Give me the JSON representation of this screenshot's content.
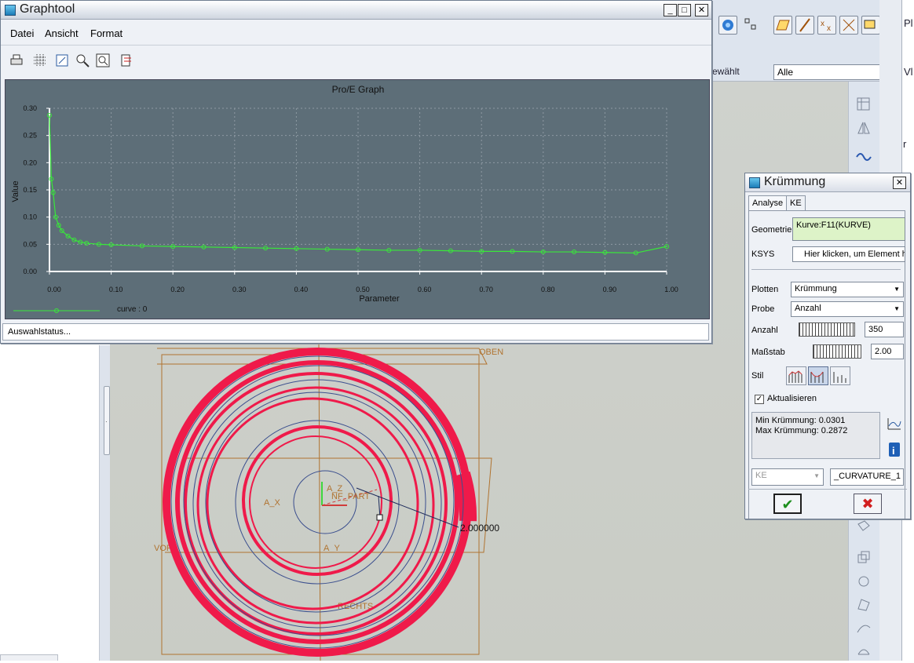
{
  "graphtool": {
    "title": "Graphtool",
    "menu": [
      "Datei",
      "Ansicht",
      "Format"
    ],
    "status": "Auswahlstatus...",
    "toolbar_icons": [
      "printer-icon",
      "grid-toggle-icon",
      "zoom-fit-icon",
      "zoom-in-icon",
      "zoom-window-icon",
      "export-icon"
    ]
  },
  "chart_data": {
    "type": "line",
    "title": "Pro/E Graph",
    "xlabel": "Parameter",
    "ylabel": "Value",
    "xlim": [
      0,
      1
    ],
    "ylim": [
      0,
      0.3
    ],
    "xticks": [
      "0.00",
      "0.10",
      "0.20",
      "0.30",
      "0.40",
      "0.50",
      "0.60",
      "0.70",
      "0.80",
      "0.90",
      "1.00"
    ],
    "yticks": [
      "0.00",
      "0.05",
      "0.10",
      "0.15",
      "0.20",
      "0.25",
      "0.30"
    ],
    "grid": true,
    "legend": "bottom-left",
    "series": [
      {
        "name": "curve : 0",
        "color": "#39e83a",
        "x": [
          0,
          0.003,
          0.006,
          0.01,
          0.015,
          0.02,
          0.03,
          0.04,
          0.05,
          0.06,
          0.08,
          0.1,
          0.15,
          0.2,
          0.25,
          0.3,
          0.35,
          0.4,
          0.45,
          0.5,
          0.55,
          0.6,
          0.65,
          0.7,
          0.75,
          0.8,
          0.85,
          0.9,
          0.95,
          1.0
        ],
        "y": [
          0.287,
          0.17,
          0.145,
          0.1,
          0.085,
          0.075,
          0.065,
          0.058,
          0.054,
          0.052,
          0.05,
          0.049,
          0.047,
          0.046,
          0.045,
          0.044,
          0.043,
          0.042,
          0.041,
          0.04,
          0.039,
          0.039,
          0.038,
          0.037,
          0.037,
          0.036,
          0.036,
          0.035,
          0.034,
          0.046
        ]
      }
    ]
  },
  "dialog": {
    "title": "Krümmung",
    "tabs": [
      "Analyse",
      "KE"
    ],
    "geometrie_label": "Geometrie",
    "geometrie_value": "Kurve:F11(KURVE)",
    "ksys_label": "KSYS",
    "ksys_value": "Hier klicken, um Element hi",
    "plotten_label": "Plotten",
    "plotten_value": "Krümmung",
    "probe_label": "Probe",
    "probe_value": "Anzahl",
    "anzahl_label": "Anzahl",
    "anzahl_value": "350",
    "massstab_label": "Maßstab",
    "massstab_value": "2.00",
    "stil_label": "Stil",
    "aktualisieren_label": "Aktualisieren",
    "aktualisieren_checked": true,
    "min_text": "Min Krümmung: 0.0301",
    "max_text": "Max Krümmung: 0.2872",
    "ke_select": "KE",
    "feature_name": "_CURVATURE_1"
  },
  "main": {
    "filter_label": "ewählt",
    "filter_value": "Alle",
    "edge_labels": [
      "Pl",
      "Vl",
      "r"
    ],
    "viewport_labels": {
      "oben": "OBEN",
      "rechts": "RECHTS",
      "vorne": "VOR",
      "a_x": "A_X",
      "a_y": "A_Y",
      "a_z": "A_Z",
      "nf_part": "NF_PART",
      "dimension": "2.000000"
    }
  }
}
